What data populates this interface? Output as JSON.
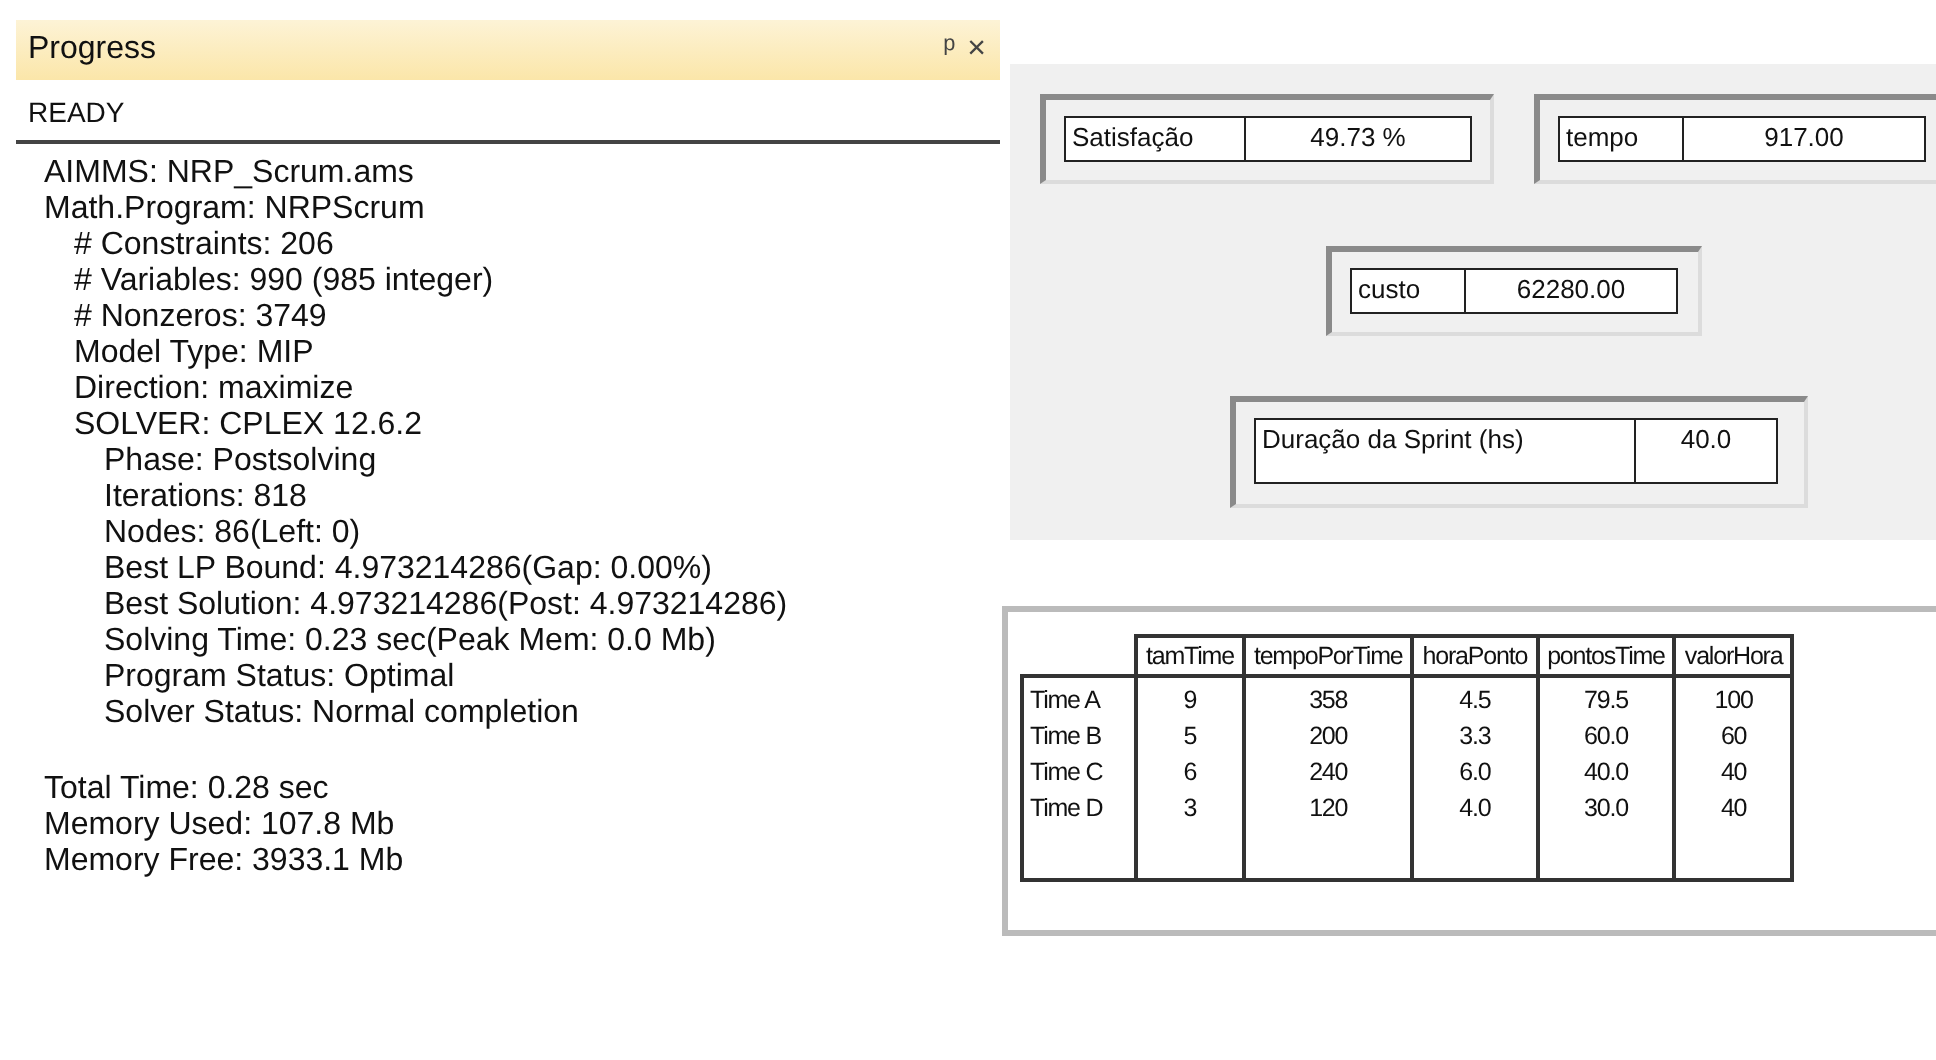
{
  "panel": {
    "title": "Progress",
    "pin": "ᵖ",
    "close": "×",
    "status": "READY",
    "sections": [
      [
        {
          "label": "AIMMS",
          "value": ": NRP_Scrum.ams"
        },
        {
          "label": "Math.Program",
          "value": ": NRPScrum",
          "children": [
            {
              "label": "# Constraints",
              "value": ": 206"
            },
            {
              "label": "# Variables",
              "value": ": 990   (985 integer)"
            },
            {
              "label": "# Nonzeros",
              "value": ": 3749"
            },
            {
              "label": "Model Type",
              "value": ": MIP"
            },
            {
              "label": "Direction",
              "value": ": maximize"
            },
            {
              "label": "SOLVER",
              "value": ": CPLEX 12.6.2",
              "children": [
                {
                  "label": "Phase",
                  "value": ": Postsolving"
                },
                {
                  "label": "Iterations",
                  "value": ": 818"
                },
                {
                  "label": "Nodes",
                  "value": ": 86",
                  "extra": "(Left: 0)"
                },
                {
                  "label": "Best LP Bound",
                  "value": ": 4.973214286",
                  "extra": "(Gap: 0.00%)"
                },
                {
                  "label": "Best Solution",
                  "value": ": 4.973214286",
                  "extra": "(Post: 4.973214286)"
                },
                {
                  "label": "Solving Time",
                  "value": ": 0.23 sec",
                  "extra": "(Peak Mem: 0.0 Mb)"
                },
                {
                  "label": "Program Status",
                  "value": ": Optimal"
                },
                {
                  "label": "Solver Status",
                  "value": ": Normal completion"
                }
              ]
            }
          ]
        }
      ],
      [
        {
          "label": "Total Time",
          "value": ": 0.28 sec"
        },
        {
          "label": "Memory Used",
          "value": ": 107.8 Mb"
        },
        {
          "label": "Memory Free",
          "value": ": 3933.1 Mb"
        }
      ]
    ]
  },
  "fields": [
    {
      "label": "Satisfação",
      "value": "49.73  %"
    },
    {
      "label": "tempo",
      "value": "917.00"
    },
    {
      "label": "custo",
      "value": "62280.00"
    },
    {
      "label": "Duração da Sprint (hs)",
      "value": "40.0"
    }
  ],
  "table": {
    "columns": [
      "tamTime",
      "tempoPorTime",
      "horaPonto",
      "pontosTime",
      "valorHora"
    ],
    "rows": [
      {
        "name": "Time A",
        "cells": [
          "9",
          "358",
          "4.5",
          "79.5",
          "100"
        ]
      },
      {
        "name": "Time B",
        "cells": [
          "5",
          "200",
          "3.3",
          "60.0",
          "60"
        ]
      },
      {
        "name": "Time C",
        "cells": [
          "6",
          "240",
          "6.0",
          "40.0",
          "40"
        ]
      },
      {
        "name": "Time D",
        "cells": [
          "3",
          "120",
          "4.0",
          "30.0",
          "40"
        ]
      }
    ]
  }
}
